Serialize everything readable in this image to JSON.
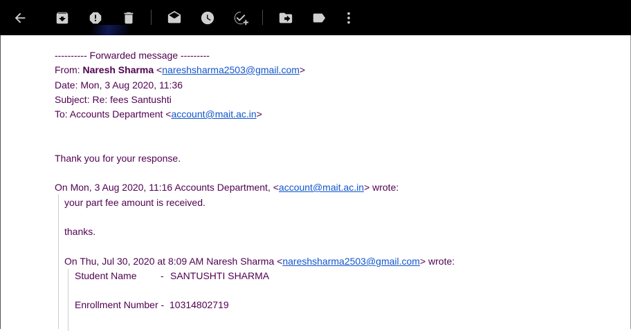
{
  "toolbar": {
    "buttons": [
      {
        "name": "back",
        "icon": "arrow-left-icon"
      },
      {
        "name": "archive",
        "icon": "archive-icon"
      },
      {
        "name": "report-spam",
        "icon": "exclamation-icon"
      },
      {
        "name": "delete",
        "icon": "trash-icon"
      },
      {
        "name": "mark-unread",
        "icon": "envelope-open-icon"
      },
      {
        "name": "snooze",
        "icon": "clock-icon"
      },
      {
        "name": "add-to-tasks",
        "icon": "check-add-icon"
      },
      {
        "name": "move-to",
        "icon": "folder-arrow-icon"
      },
      {
        "name": "labels",
        "icon": "label-icon"
      },
      {
        "name": "more",
        "icon": "more-vert-icon"
      }
    ]
  },
  "email": {
    "forwarded_header": "---------- Forwarded message ---------",
    "from_label": "From: ",
    "from_name": "Naresh Sharma",
    "from_email": "nareshsharma2503@gmail.com",
    "date": "Date: Mon, 3 Aug 2020, 11:36",
    "subject": "Subject: Re: fees Santushti",
    "to_label": "To: Accounts Department <",
    "to_email": "account@mait.ac.in",
    "body": "Thank you for your response.",
    "quote1_prefix": "On Mon, 3 Aug 2020, 11:16 Accounts Department, <",
    "quote1_email": "account@mait.ac.in",
    "quote1_suffix": "> wrote:",
    "quote1_line1": "your part fee amount is received.",
    "quote1_line2": "thanks.",
    "quote2_prefix": "On Thu, Jul 30, 2020 at 8:09 AM Naresh Sharma <",
    "quote2_email": "nareshsharma2503@gmail.com",
    "quote2_suffix": "> wrote:",
    "student_name_label": "Student Name",
    "student_name_sep": "-",
    "student_name_value": "SANTUSHTI SHARMA",
    "enrollment_label": "Enrollment Number -",
    "enrollment_value": "10314802719"
  },
  "colors": {
    "toolbar_bg": "#000000",
    "text": "#500050",
    "link": "#1155cc"
  }
}
